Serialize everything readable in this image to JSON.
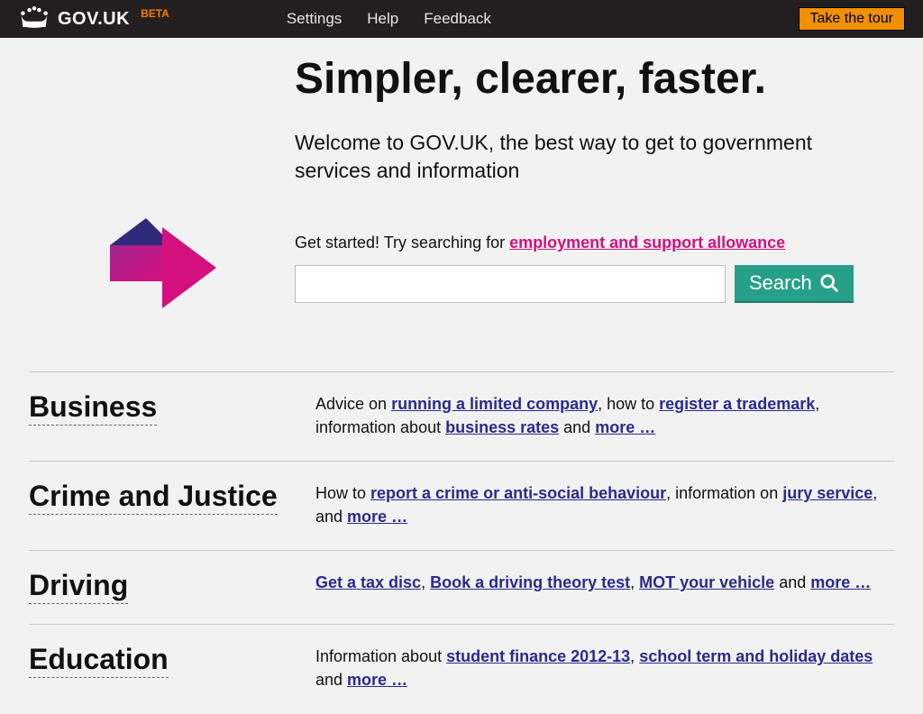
{
  "header": {
    "site_name": "GOV.UK",
    "beta": "BETA",
    "nav": [
      "Settings",
      "Help",
      "Feedback"
    ],
    "tour": "Take the tour"
  },
  "hero": {
    "headline": "Simpler, clearer, faster.",
    "welcome": "Welcome to GOV.UK, the best way to get to government services and information",
    "prompt_prefix": "Get started! Try searching for ",
    "suggestion": "employment and support allowance",
    "search_button": "Search"
  },
  "categories": [
    {
      "title": "Business",
      "parts": [
        {
          "t": "Advice on "
        },
        {
          "t": "running a limited company",
          "l": true
        },
        {
          "t": ", how to "
        },
        {
          "t": "register a trademark",
          "l": true
        },
        {
          "t": ", information about "
        },
        {
          "t": "business rates",
          "l": true
        },
        {
          "t": " and "
        },
        {
          "t": "more …",
          "l": true
        }
      ]
    },
    {
      "title": "Crime and Justice",
      "parts": [
        {
          "t": "How to "
        },
        {
          "t": "report a crime or anti-social behaviour",
          "l": true
        },
        {
          "t": ", information on "
        },
        {
          "t": "jury service",
          "l": true
        },
        {
          "t": ", and "
        },
        {
          "t": "more …",
          "l": true
        }
      ]
    },
    {
      "title": "Driving",
      "parts": [
        {
          "t": "Get a tax disc",
          "l": true
        },
        {
          "t": ", "
        },
        {
          "t": "Book a driving theory test",
          "l": true
        },
        {
          "t": ", "
        },
        {
          "t": "MOT your vehicle",
          "l": true
        },
        {
          "t": " and "
        },
        {
          "t": "more …",
          "l": true
        }
      ]
    },
    {
      "title": "Education",
      "parts": [
        {
          "t": "Information about "
        },
        {
          "t": "student finance 2012-13",
          "l": true
        },
        {
          "t": ", "
        },
        {
          "t": "school term and holiday dates",
          "l": true
        },
        {
          "t": " and "
        },
        {
          "t": "more …",
          "l": true
        }
      ]
    }
  ]
}
